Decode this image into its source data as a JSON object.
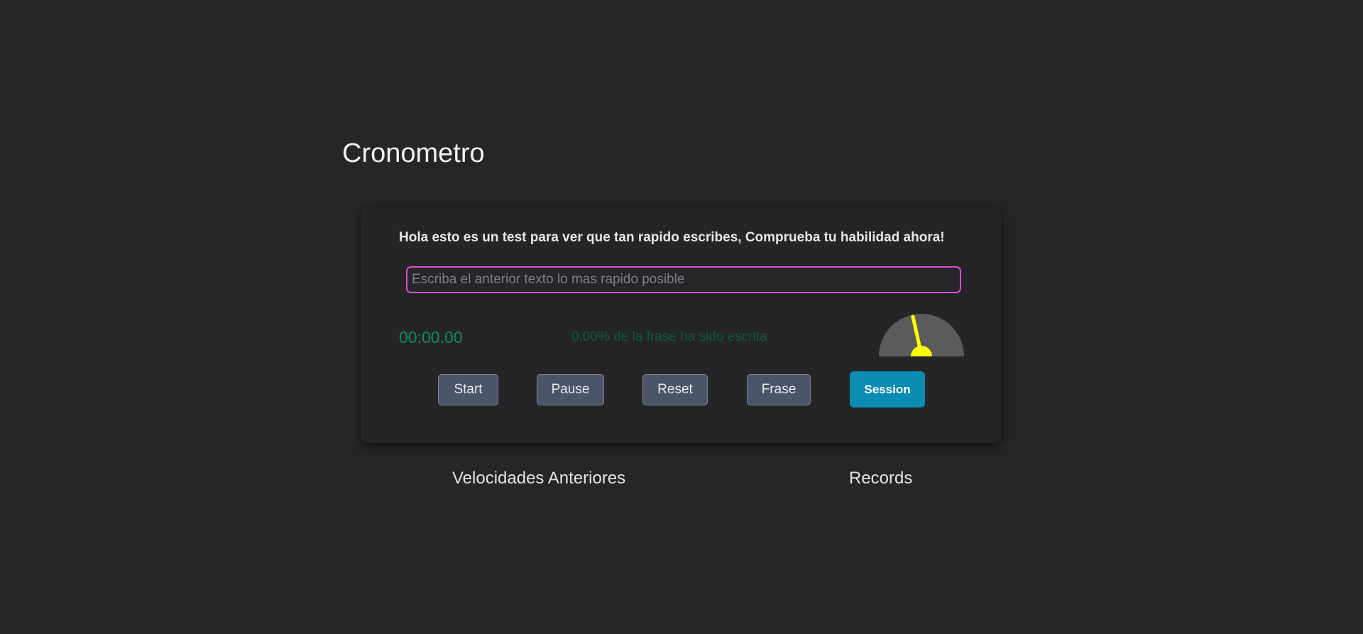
{
  "page": {
    "title": "Cronometro"
  },
  "test": {
    "phrase": "Hola esto es un test para ver que tan rapido escribes, Comprueba tu habilidad ahora!",
    "input_placeholder": "Escriba el anterior texto lo mas rapido posible",
    "input_value": "",
    "timer": "00:00.00",
    "progress_text": "0.00% de la frase ha sido escrita",
    "progress_percent": 0
  },
  "gauge": {
    "needle_icon": "speedometer-icon",
    "colors": {
      "dial": "#5b5b5b",
      "needle": "#ffff00"
    }
  },
  "controls": {
    "start_label": "Start",
    "pause_label": "Pause",
    "reset_label": "Reset",
    "frase_label": "Frase",
    "session_label": "Session"
  },
  "sections": {
    "previous_speeds": "Velocidades Anteriores",
    "records": "Records"
  },
  "colors": {
    "background": "#262628",
    "input_border": "#d64fd6",
    "timer": "#0f8a5c",
    "progress": "#0d5a3f",
    "button": "#4a5568",
    "session_button": "#0b8cb2"
  }
}
